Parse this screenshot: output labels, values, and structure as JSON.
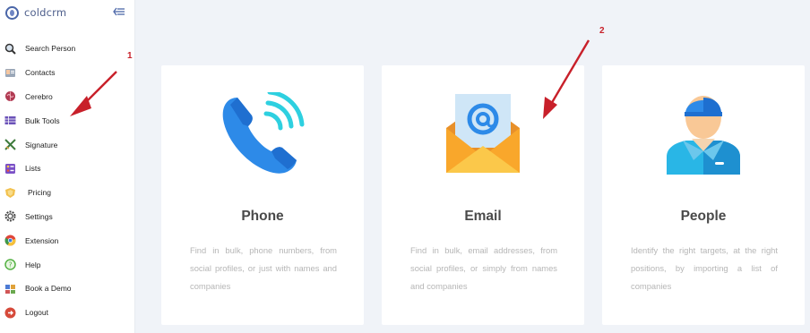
{
  "brand": {
    "name": "coldcrm",
    "logo_icon": "coldcrm-logo-icon",
    "collapse_icon": "collapse-menu-icon"
  },
  "sidebar": {
    "items": [
      {
        "label": "Search Person",
        "icon": "search-person-icon"
      },
      {
        "label": "Contacts",
        "icon": "contacts-icon"
      },
      {
        "label": "Cerebro",
        "icon": "cerebro-icon"
      },
      {
        "label": "Bulk Tools",
        "icon": "bulk-tools-icon"
      },
      {
        "label": "Signature",
        "icon": "signature-icon"
      },
      {
        "label": "Lists",
        "icon": "lists-icon"
      },
      {
        "label": "Pricing",
        "icon": "pricing-icon"
      },
      {
        "label": "Settings",
        "icon": "settings-icon"
      },
      {
        "label": "Extension",
        "icon": "extension-icon"
      },
      {
        "label": "Help",
        "icon": "help-icon"
      },
      {
        "label": "Book a Demo",
        "icon": "book-demo-icon"
      },
      {
        "label": "Logout",
        "icon": "logout-icon"
      }
    ]
  },
  "cards": [
    {
      "title": "Phone",
      "icon": "phone-icon",
      "description": "Find in bulk, phone numbers, from social profiles, or just with names and companies"
    },
    {
      "title": "Email",
      "icon": "email-envelope-icon",
      "description": "Find in bulk, email addresses, from social profiles, or simply from names and companies"
    },
    {
      "title": "People",
      "icon": "person-icon",
      "description": "Identify the right targets, at the right positions, by importing a list of companies"
    }
  ],
  "annotations": [
    {
      "label": "1"
    },
    {
      "label": "2"
    }
  ],
  "colors": {
    "accent": "#4a66a8",
    "annotation": "#c8202a",
    "background": "#f0f3f8",
    "phone_blue": "#2d8ae8",
    "email_orange": "#f9a72b"
  }
}
